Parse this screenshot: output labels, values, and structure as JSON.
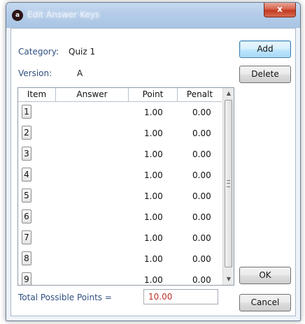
{
  "window": {
    "title": "Edit Answer Keys",
    "close_glyph": "x",
    "app_icon_glyph": "a"
  },
  "form": {
    "category_label": "Category:",
    "category_value": "Quiz 1",
    "version_label": "Version:",
    "version_value": "A",
    "total_label": "Total Possible Points =",
    "total_value": "10.00"
  },
  "buttons": {
    "add": "Add",
    "delete": "Delete",
    "ok": "OK",
    "cancel": "Cancel"
  },
  "grid": {
    "columns": [
      "Item",
      "Answer",
      "Point",
      "Penalt"
    ],
    "rows": [
      {
        "item": "1",
        "answer": "",
        "point": "1.00",
        "penalty": "0.00"
      },
      {
        "item": "2",
        "answer": "",
        "point": "1.00",
        "penalty": "0.00"
      },
      {
        "item": "3",
        "answer": "",
        "point": "1.00",
        "penalty": "0.00"
      },
      {
        "item": "4",
        "answer": "",
        "point": "1.00",
        "penalty": "0.00"
      },
      {
        "item": "5",
        "answer": "",
        "point": "1.00",
        "penalty": "0.00"
      },
      {
        "item": "6",
        "answer": "",
        "point": "1.00",
        "penalty": "0.00"
      },
      {
        "item": "7",
        "answer": "",
        "point": "1.00",
        "penalty": "0.00"
      },
      {
        "item": "8",
        "answer": "",
        "point": "1.00",
        "penalty": "0.00"
      },
      {
        "item": "9",
        "answer": "",
        "point": "1.00",
        "penalty": "0.00"
      }
    ],
    "scroll_up_glyph": "▲",
    "scroll_down_glyph": "▼"
  },
  "colors": {
    "label_blue": "#2f4f80",
    "total_red": "#c0302a"
  }
}
